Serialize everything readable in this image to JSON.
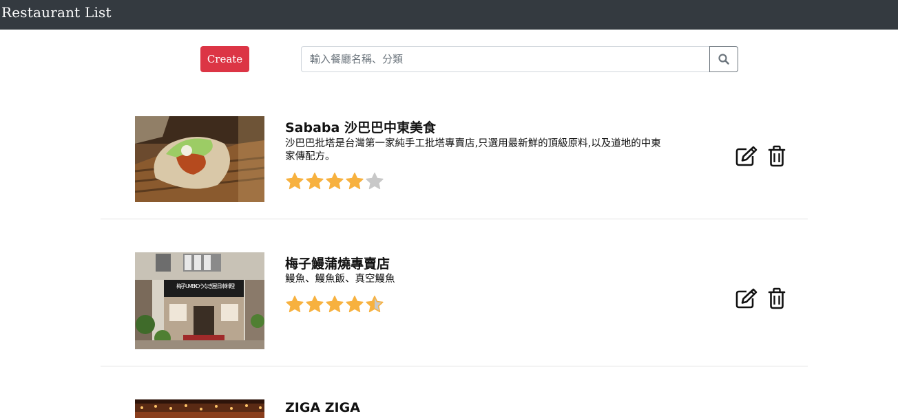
{
  "navbar": {
    "brand": "Restaurant List"
  },
  "toolbar": {
    "create_label": "Create"
  },
  "search": {
    "placeholder": "輸入餐廳名稱、分類",
    "value": ""
  },
  "icons": {
    "search": "search-icon",
    "edit": "edit-icon",
    "delete": "trash-icon"
  },
  "colors": {
    "navbar": "#343a40",
    "create_button": "#dc3545",
    "star_filled": "#f7b13f",
    "star_empty": "#c8c8c8"
  },
  "restaurants": [
    {
      "name": "Sababa 沙巴巴中東美食",
      "description": "沙巴巴批塔是台灣第一家純手工批塔專賣店,只選用最新鮮的頂級原料,以及道地的中東家傳配方。",
      "rating": 4.0,
      "rating_max": 5
    },
    {
      "name": "梅子鰻蒲燒專賣店",
      "description": "鰻魚、鰻魚飯、真空鰻魚",
      "rating": 4.5,
      "rating_max": 5,
      "photo_sign": "梅子 UMEKO うなぎ屋 日本料理"
    },
    {
      "name": "ZIGA ZIGA",
      "description": "",
      "rating": null,
      "rating_max": 5
    }
  ]
}
